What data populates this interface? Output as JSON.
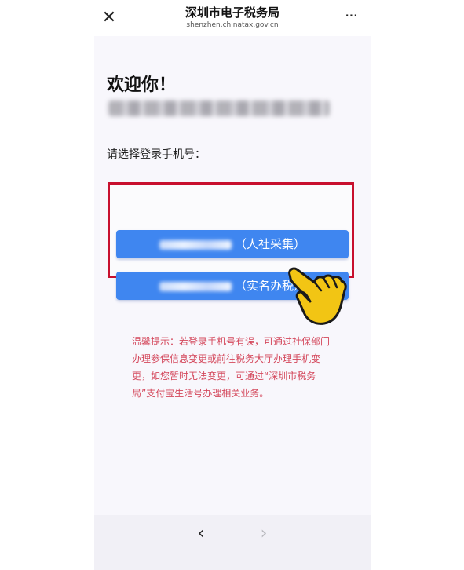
{
  "topbar": {
    "title": "深圳市电子税务局",
    "domain": "shenzhen.chinatax.gov.cn",
    "close_icon": "close-icon",
    "more_icon": "more-icon"
  },
  "main": {
    "welcome": "欢迎你！",
    "choose_label": "请选择登录手机号：",
    "phone_options": [
      {
        "suffix": "（人社采集）"
      },
      {
        "suffix": "（实名办税）"
      }
    ],
    "notice": "温馨提示：若登录手机号有误，可通过社保部门办理参保信息变更或前往税务大厅办理手机变更，如您暂时无法变更，可通过“深圳市税务局”支付宝生活号办理相关业务。"
  },
  "bottom": {
    "back_glyph": "‹",
    "forward_glyph": "›"
  },
  "colors": {
    "button": "#3f86f0",
    "highlight_border": "#c8102e",
    "notice_text": "#d4485c",
    "hand": "#f2c514"
  }
}
